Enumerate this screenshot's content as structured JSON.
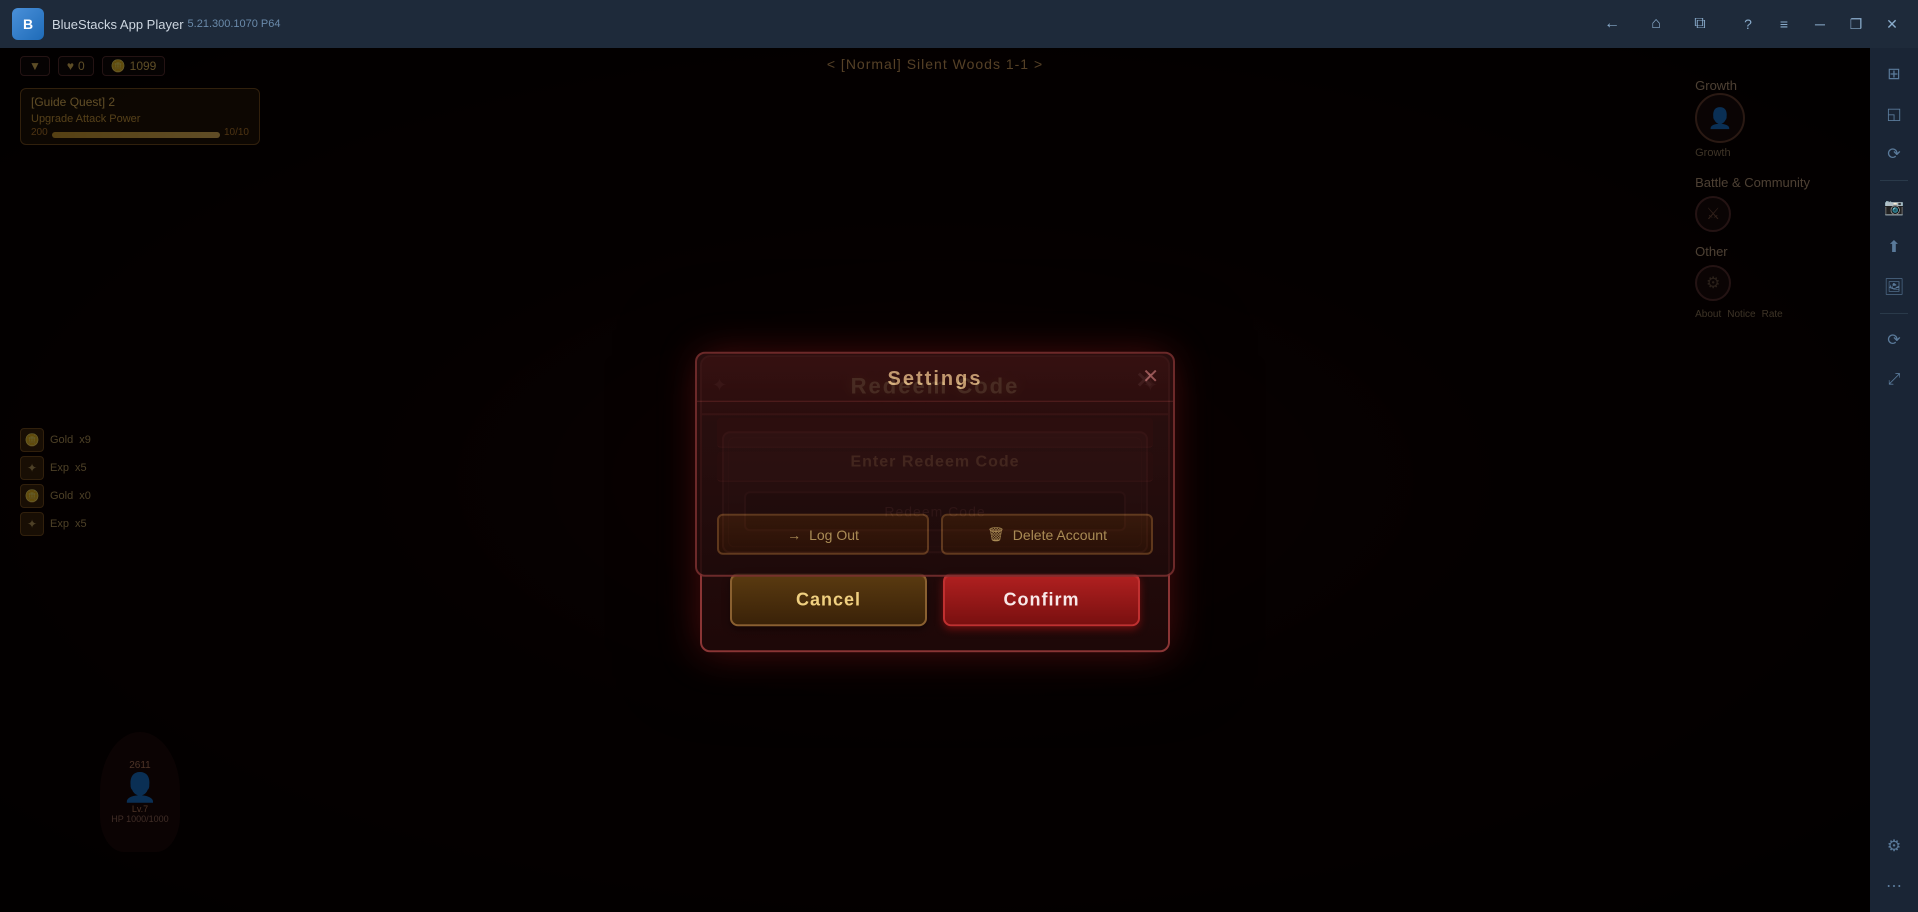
{
  "titlebar": {
    "app_name": "BlueStacks App Player",
    "version": "5.21.300.1070  P64",
    "logo_text": "B",
    "nav": {
      "back_label": "←",
      "home_label": "⌂",
      "copy_label": "⧉"
    },
    "controls": {
      "help": "?",
      "menu": "≡",
      "minimize": "─",
      "restore": "❐",
      "close": "✕"
    }
  },
  "sidebar": {
    "buttons": [
      "⊞",
      "◎",
      "⟳",
      "📷",
      "⬆",
      "📷",
      "⟳",
      "⚙",
      "⋯"
    ]
  },
  "hud": {
    "level_icon": "▼",
    "health_icon": "♥",
    "health_value": "0",
    "coin_icon": "🪙",
    "coin_value": "1099",
    "location": "< [Normal] Silent Woods 1-1 >"
  },
  "quest": {
    "title": "[Guide Quest] 2",
    "description": "Upgrade Attack Power",
    "progress": "200",
    "progress_bar": "10/10"
  },
  "game_items": [
    {
      "icon": "🪙",
      "name": "Gold",
      "count": "x9"
    },
    {
      "icon": "✦",
      "name": "Exp",
      "count": "x5"
    },
    {
      "icon": "🪙",
      "name": "Gold",
      "count": "x0"
    },
    {
      "icon": "✦",
      "name": "Exp",
      "count": "x5"
    }
  ],
  "character": {
    "level": "7",
    "hp": "HP 1000/1000",
    "atk": "2611"
  },
  "game_right": {
    "growth_label": "Growth",
    "battle_label": "Battle & Community",
    "other_label": "Other"
  },
  "settings": {
    "title": "Settings",
    "close_icon": "✕",
    "logout_label": "Log Out",
    "delete_account_label": "Delete Account",
    "logout_icon": "→",
    "delete_icon": "🗑"
  },
  "redeem": {
    "title": "Redeem Code",
    "close_icon": "✕",
    "input_label": "Enter Redeem Code",
    "input_placeholder": "Redeem Code",
    "cancel_label": "Cancel",
    "confirm_label": "Confirm",
    "deco_left": "✦",
    "deco_right": "✦"
  }
}
